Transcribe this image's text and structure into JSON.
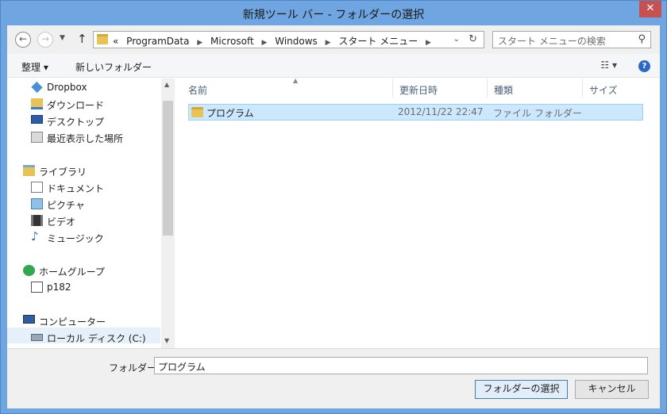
{
  "window": {
    "title": "新規ツール バー - フォルダーの選択",
    "close_label": "✕"
  },
  "address": {
    "back_icon": "back-arrow-icon",
    "crumbs": [
      "«",
      "ProgramData",
      "Microsoft",
      "Windows",
      "スタート メニュー"
    ],
    "separator": "▶"
  },
  "search": {
    "placeholder": "スタート メニューの検索"
  },
  "toolbar": {
    "organize_label": "整理 ▾",
    "new_folder_label": "新しいフォルダー",
    "help_label": "?"
  },
  "nav": {
    "items": [
      {
        "label": "Dropbox",
        "icon": "dropbox-icon"
      },
      {
        "label": "ダウンロード",
        "icon": "download-folder-icon"
      },
      {
        "label": "デスクトップ",
        "icon": "desktop-icon"
      },
      {
        "label": "最近表示した場所",
        "icon": "recent-places-icon"
      },
      {
        "label": "ライブラリ",
        "icon": "library-icon"
      },
      {
        "label": "ドキュメント",
        "icon": "documents-icon"
      },
      {
        "label": "ピクチャ",
        "icon": "pictures-icon"
      },
      {
        "label": "ビデオ",
        "icon": "videos-icon"
      },
      {
        "label": "ミュージック",
        "icon": "music-icon"
      },
      {
        "label": "ホームグループ",
        "icon": "homegroup-icon"
      },
      {
        "label": "p182",
        "icon": "user-icon"
      },
      {
        "label": "コンピューター",
        "icon": "computer-icon"
      },
      {
        "label": "ローカル ディスク (C:)",
        "icon": "local-disk-icon"
      }
    ]
  },
  "columns": {
    "name": "名前",
    "date": "更新日時",
    "type": "種類",
    "size": "サイズ"
  },
  "files": [
    {
      "name": "プログラム",
      "date": "2012/11/22 22:47",
      "type": "ファイル フォルダー"
    }
  ],
  "footer": {
    "folder_label": "フォルダー:",
    "folder_value": "プログラム",
    "select_button": "フォルダーの選択",
    "cancel_button": "キャンセル"
  }
}
